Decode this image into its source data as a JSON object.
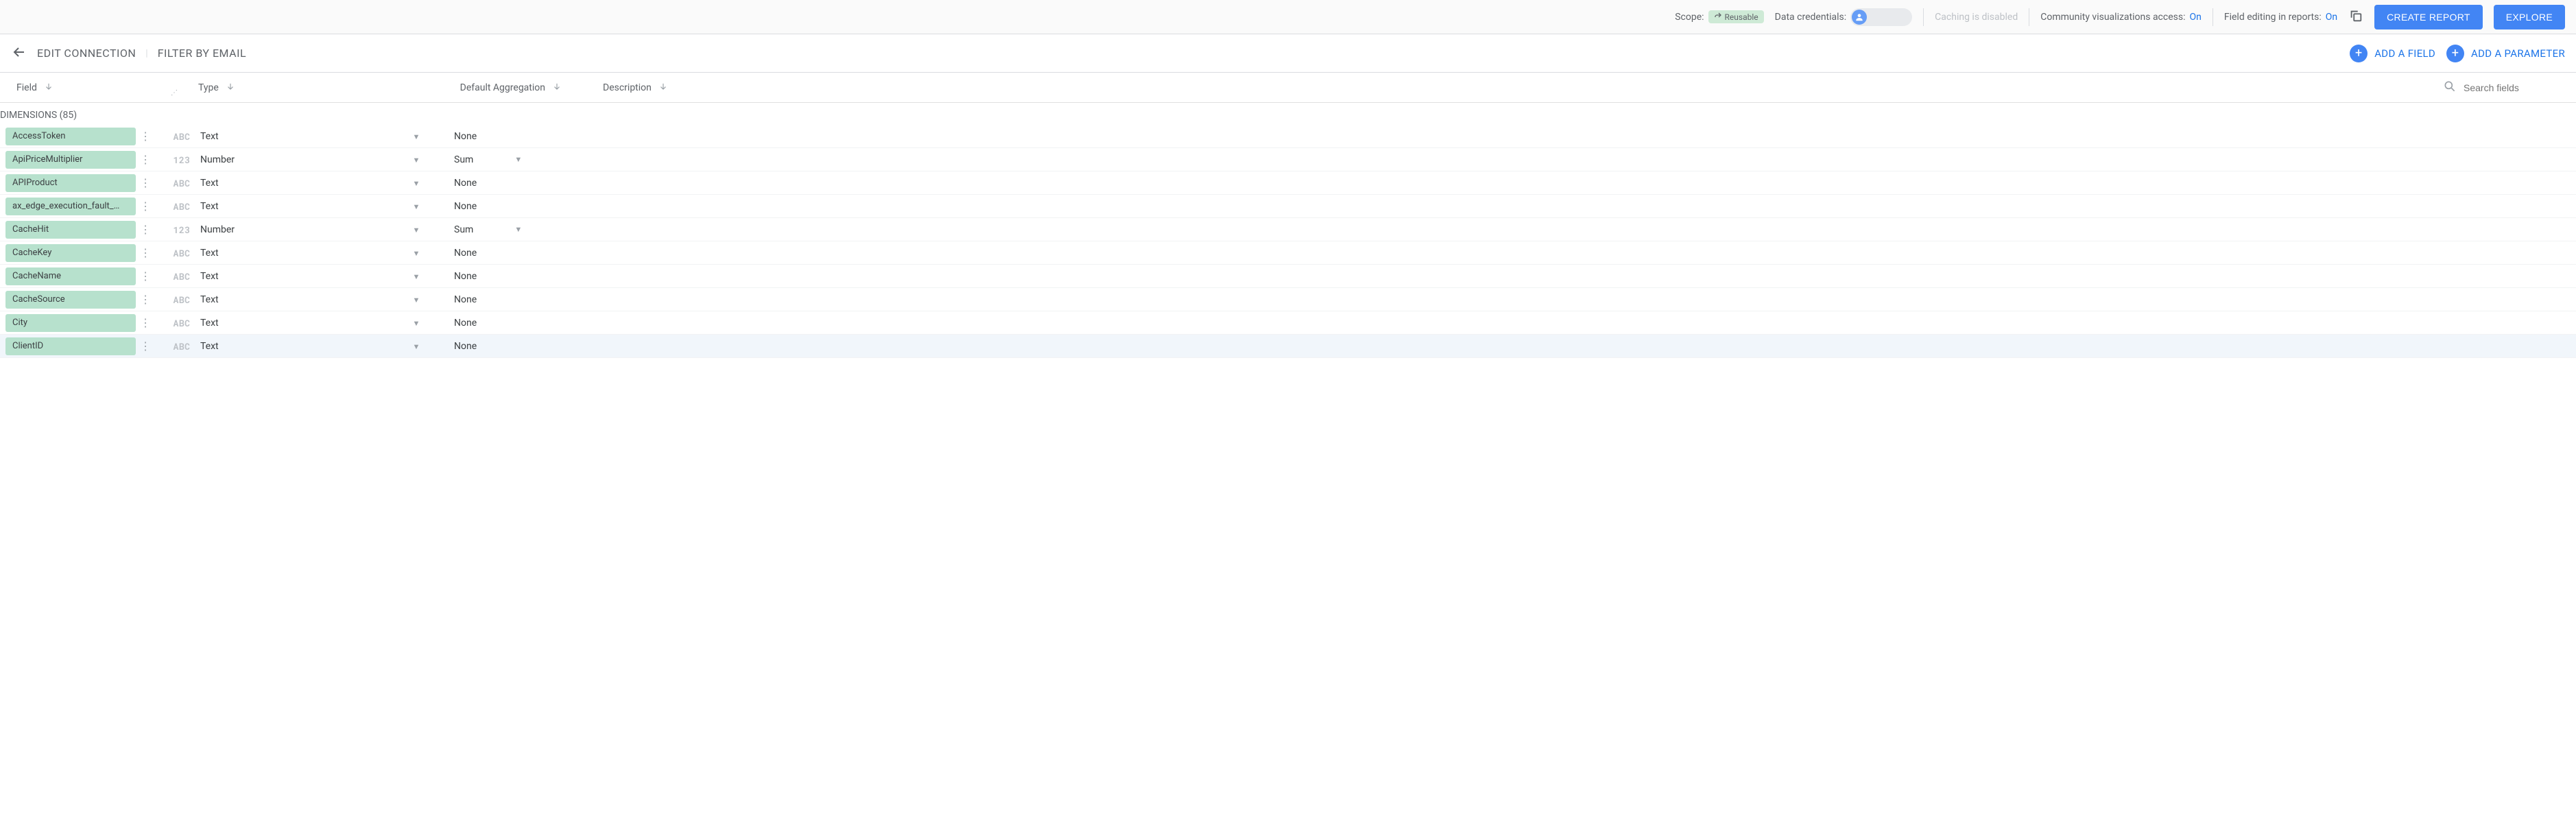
{
  "info_bar": {
    "scope_label": "Scope:",
    "reusable_label": "Reusable",
    "data_credentials_label": "Data credentials:",
    "caching_label": "Caching is disabled",
    "community_viz_label": "Community visualizations access:",
    "community_viz_value": "On",
    "field_editing_label": "Field editing in reports:",
    "field_editing_value": "On",
    "create_report_btn": "CREATE REPORT",
    "explore_btn": "EXPLORE"
  },
  "nav": {
    "edit_connection": "EDIT CONNECTION",
    "filter_by_email": "FILTER BY EMAIL",
    "add_field": "ADD A FIELD",
    "add_parameter": "ADD A PARAMETER"
  },
  "table": {
    "columns": {
      "field": "Field",
      "type": "Type",
      "aggregation": "Default Aggregation",
      "description": "Description"
    },
    "search_placeholder": "Search fields",
    "dimensions_header": "DIMENSIONS (85)"
  },
  "type_labels": {
    "text": "Text",
    "number": "Number"
  },
  "type_icons": {
    "text": "ABC",
    "number": "123"
  },
  "agg_labels": {
    "none": "None",
    "sum": "Sum"
  },
  "fields": [
    {
      "name": "AccessToken",
      "type": "text",
      "agg": "none",
      "agg_dd": false
    },
    {
      "name": "ApiPriceMultiplier",
      "type": "number",
      "agg": "sum",
      "agg_dd": true
    },
    {
      "name": "APIProduct",
      "type": "text",
      "agg": "none",
      "agg_dd": false
    },
    {
      "name": "ax_edge_execution_fault_…",
      "type": "text",
      "agg": "none",
      "agg_dd": false
    },
    {
      "name": "CacheHit",
      "type": "number",
      "agg": "sum",
      "agg_dd": true
    },
    {
      "name": "CacheKey",
      "type": "text",
      "agg": "none",
      "agg_dd": false
    },
    {
      "name": "CacheName",
      "type": "text",
      "agg": "none",
      "agg_dd": false
    },
    {
      "name": "CacheSource",
      "type": "text",
      "agg": "none",
      "agg_dd": false
    },
    {
      "name": "City",
      "type": "text",
      "agg": "none",
      "agg_dd": false
    },
    {
      "name": "ClientID",
      "type": "text",
      "agg": "none",
      "agg_dd": false,
      "hovered": true
    }
  ]
}
